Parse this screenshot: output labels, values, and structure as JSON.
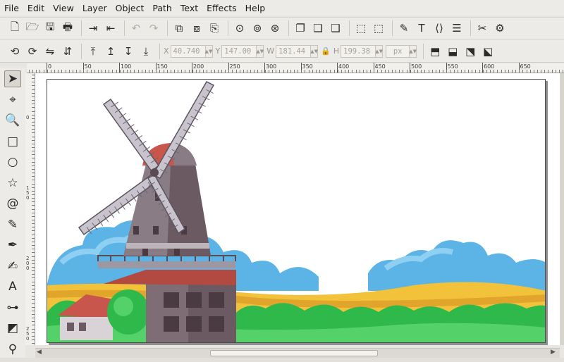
{
  "menu": [
    "File",
    "Edit",
    "View",
    "Layer",
    "Object",
    "Path",
    "Text",
    "Effects",
    "Help"
  ],
  "toolbar_main": [
    {
      "name": "new-document-icon",
      "glyph": "🗋"
    },
    {
      "name": "open-icon",
      "glyph": "🗁"
    },
    {
      "name": "save-icon",
      "glyph": "🖫"
    },
    {
      "name": "print-icon",
      "glyph": "🖶"
    },
    {
      "name": "import-icon",
      "glyph": "⇥"
    },
    {
      "name": "export-icon",
      "glyph": "⇤"
    },
    {
      "name": "undo-icon",
      "glyph": "↶"
    },
    {
      "name": "redo-icon",
      "glyph": "↷"
    },
    {
      "name": "copy-icon",
      "glyph": "⧉"
    },
    {
      "name": "cut-icon",
      "glyph": "⧇"
    },
    {
      "name": "paste-icon",
      "glyph": "⎘"
    },
    {
      "name": "zoom-selection-icon",
      "glyph": "⊙"
    },
    {
      "name": "zoom-drawing-icon",
      "glyph": "⊚"
    },
    {
      "name": "zoom-page-icon",
      "glyph": "⊛"
    },
    {
      "name": "duplicate-icon",
      "glyph": "❐"
    },
    {
      "name": "clone-icon",
      "glyph": "❏"
    },
    {
      "name": "unlink-clone-icon",
      "glyph": "❑"
    },
    {
      "name": "group-icon",
      "glyph": "⬚"
    },
    {
      "name": "ungroup-icon",
      "glyph": "⬚"
    },
    {
      "name": "fill-stroke-icon",
      "glyph": "✎"
    },
    {
      "name": "text-font-icon",
      "glyph": "T"
    },
    {
      "name": "xml-editor-icon",
      "glyph": "⟨⟩"
    },
    {
      "name": "align-distribute-icon",
      "glyph": "☰"
    },
    {
      "name": "preferences-icon",
      "glyph": "✂"
    },
    {
      "name": "document-properties-icon",
      "glyph": "⚙"
    }
  ],
  "toolbar_select": [
    {
      "name": "rotate-ccw-icon",
      "glyph": "⟲"
    },
    {
      "name": "rotate-cw-icon",
      "glyph": "⟳"
    },
    {
      "name": "flip-horizontal-icon",
      "glyph": "⇋"
    },
    {
      "name": "flip-vertical-icon",
      "glyph": "⇵"
    },
    {
      "name": "raise-to-top-icon",
      "glyph": "⤒"
    },
    {
      "name": "raise-icon",
      "glyph": "↥"
    },
    {
      "name": "lower-icon",
      "glyph": "↧"
    },
    {
      "name": "lower-to-bottom-icon",
      "glyph": "⤓"
    }
  ],
  "coords": {
    "x_label": "X",
    "x_value": "40.740",
    "y_label": "Y",
    "y_value": "147.00",
    "w_label": "W",
    "w_value": "181.44",
    "h_label": "H",
    "h_value": "199.38",
    "unit": "px"
  },
  "toolbar_transform": [
    {
      "name": "scale-stroke-icon",
      "glyph": "⬒"
    },
    {
      "name": "scale-corners-icon",
      "glyph": "⬓"
    },
    {
      "name": "transform-gradients-icon",
      "glyph": "⬔"
    },
    {
      "name": "transform-patterns-icon",
      "glyph": "⬕"
    }
  ],
  "ruler_h": [
    "0",
    "50",
    "100",
    "150",
    "200",
    "250",
    "300",
    "350",
    "400",
    "450",
    "500",
    "550",
    "600",
    "650"
  ],
  "ruler_v": [
    "0",
    "150",
    "200",
    "250"
  ],
  "tools": [
    {
      "name": "selector-tool-icon",
      "glyph": "➤",
      "active": true
    },
    {
      "name": "node-tool-icon",
      "glyph": "⌖"
    },
    {
      "name": "zoom-tool-icon",
      "glyph": "🔍"
    },
    {
      "name": "rectangle-tool-icon",
      "glyph": "□"
    },
    {
      "name": "ellipse-tool-icon",
      "glyph": "○"
    },
    {
      "name": "star-tool-icon",
      "glyph": "☆"
    },
    {
      "name": "spiral-tool-icon",
      "glyph": "@"
    },
    {
      "name": "pencil-tool-icon",
      "glyph": "✎"
    },
    {
      "name": "pen-tool-icon",
      "glyph": "✒"
    },
    {
      "name": "calligraphy-tool-icon",
      "glyph": "✍"
    },
    {
      "name": "text-tool-icon",
      "glyph": "A"
    },
    {
      "name": "connector-tool-icon",
      "glyph": "⊶"
    },
    {
      "name": "gradient-tool-icon",
      "glyph": "◩"
    },
    {
      "name": "dropper-tool-icon",
      "glyph": "⚲"
    }
  ],
  "colors": {
    "sky_cloud": "#5bb3e6",
    "cloud_light": "#8fd0f2",
    "field": "#f2c23a",
    "grass": "#2fb94a",
    "grass_light": "#55d16a",
    "mill_body": "#6b5a62",
    "mill_roof": "#c9564c",
    "sail": "#8f8a94"
  }
}
